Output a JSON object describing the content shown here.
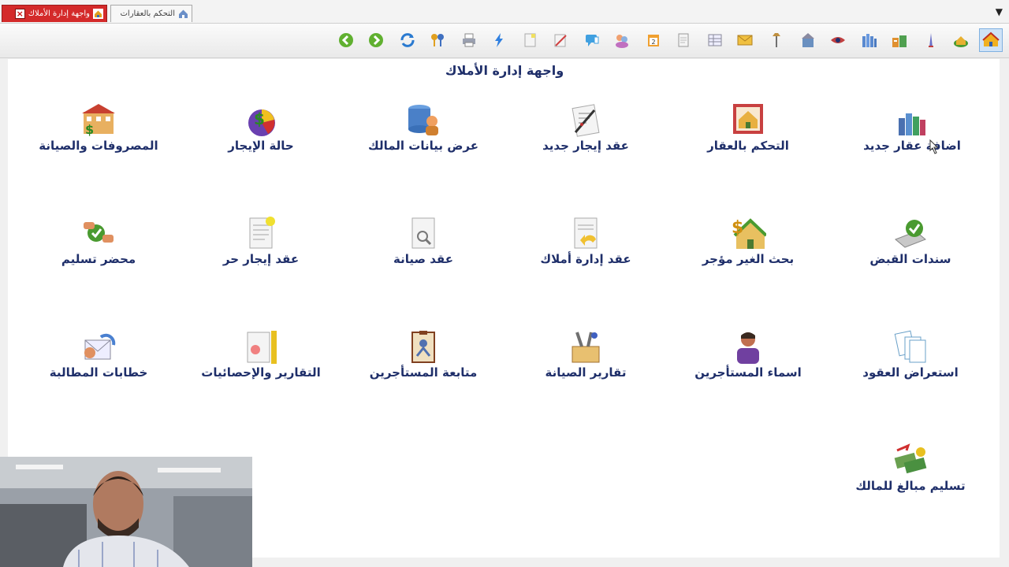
{
  "tabs": [
    {
      "label": "واجهة إدارة الأملاك",
      "active": true
    },
    {
      "label": "التحكم بالعقارات",
      "active": false
    }
  ],
  "toolbar": {
    "icons": [
      "home-icon",
      "money-house-icon",
      "tower-icon",
      "buildings-icon",
      "house-stack-icon",
      "house-eye-icon",
      "city-icon",
      "lamp-icon",
      "mail-icon",
      "grid-icon",
      "doc-icon",
      "calendar-icon",
      "users-icon",
      "chat-icon",
      "edit-icon",
      "note-icon",
      "lightning-icon",
      "print-icon",
      "keys-icon",
      "refresh-icon",
      "forward-icon",
      "back-icon"
    ]
  },
  "page": {
    "title": "واجهة إدارة الأملاك"
  },
  "items": [
    {
      "label": "اضافة عقار جديد",
      "icon": "buildings-icon"
    },
    {
      "label": "التحكم بالعقار",
      "icon": "house-frame-icon"
    },
    {
      "label": "عقد إيجار جديد",
      "icon": "contract-pen-icon"
    },
    {
      "label": "عرض بيانات المالك",
      "icon": "database-user-icon"
    },
    {
      "label": "حالة الإيجار",
      "icon": "money-pie-icon"
    },
    {
      "label": "المصروفات والصيانة",
      "icon": "house-money-icon"
    },
    {
      "label": "سندات القبض",
      "icon": "receipt-check-icon"
    },
    {
      "label": "بحث الغير مؤجر",
      "icon": "house-dollar-icon"
    },
    {
      "label": "عقد إدارة أملاك",
      "icon": "doc-return-icon"
    },
    {
      "label": "عقد صيانة",
      "icon": "doc-magnifier-icon"
    },
    {
      "label": "عقد إيجار حر",
      "icon": "doc-highlight-icon"
    },
    {
      "label": "محضر تسليم",
      "icon": "handover-icon"
    },
    {
      "label": "استعراض العقود",
      "icon": "documents-icon"
    },
    {
      "label": "اسماء المستأجرين",
      "icon": "person-icon"
    },
    {
      "label": "تقارير الصيانة",
      "icon": "tools-box-icon"
    },
    {
      "label": "متابعة المستأجرين",
      "icon": "clipboard-person-icon"
    },
    {
      "label": "التقارير والإحصائيات",
      "icon": "report-ruler-icon"
    },
    {
      "label": "خطابات المطالبة",
      "icon": "letter-icon"
    },
    {
      "label": "تسليم مبالغ للمالك",
      "icon": "money-transfer-icon"
    }
  ],
  "colors": {
    "accent": "#d42a2a",
    "label": "#1f2f6a",
    "selected": "#cfe3f7"
  }
}
